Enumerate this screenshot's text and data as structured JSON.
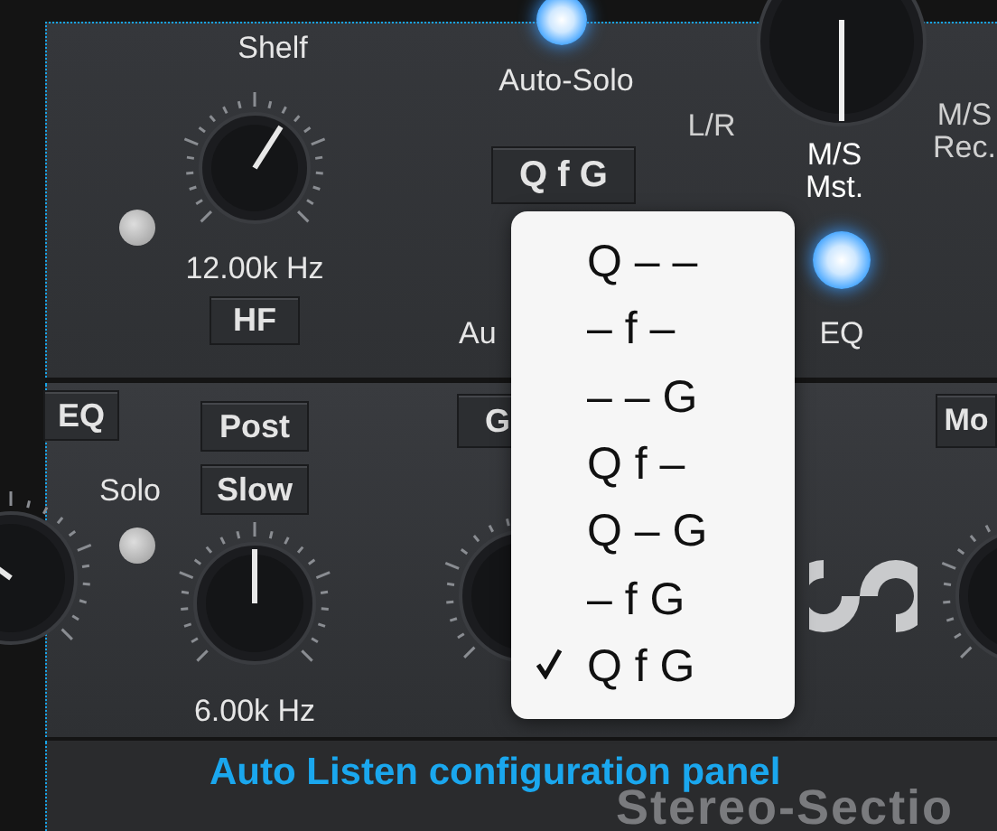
{
  "top_panel": {
    "hf_band": {
      "type_label": "Shelf",
      "knob": {
        "level": 0.62
      },
      "led": {
        "on": false
      },
      "frequency": "12.00k Hz",
      "band_button": "HF"
    },
    "auto_solo": {
      "led": {
        "on": true
      },
      "label": "Auto-Solo",
      "mode_button": "Q f G",
      "label_2": "Au"
    },
    "mode_knob": {
      "options": [
        {
          "label": "L/R",
          "selected": false
        },
        {
          "label": "M/S Mst.",
          "selected": true
        },
        {
          "label": "M/S Rec.",
          "selected": false
        }
      ]
    },
    "eq_led": {
      "on": true
    },
    "eq_label": "EQ"
  },
  "bottom_panel": {
    "eq_button": "EQ",
    "post_button": "Post",
    "slow_button": "Slow",
    "solo_label": "Solo",
    "solo_led": {
      "on": false
    },
    "knob": {
      "level": 0.5
    },
    "frequency": "6.00k Hz",
    "gain_button": "G",
    "mode_button": "Mo"
  },
  "menu": {
    "items": [
      {
        "label": "Q – –",
        "selected": false
      },
      {
        "label": "– f –",
        "selected": false
      },
      {
        "label": "– – G",
        "selected": false
      },
      {
        "label": "Q f –",
        "selected": false
      },
      {
        "label": "Q – G",
        "selected": false
      },
      {
        "label": "– f G",
        "selected": false
      },
      {
        "label": "Q f G",
        "selected": true
      }
    ]
  },
  "caption": "Auto Listen configuration panel",
  "section_title": "Stereo-Sectio"
}
